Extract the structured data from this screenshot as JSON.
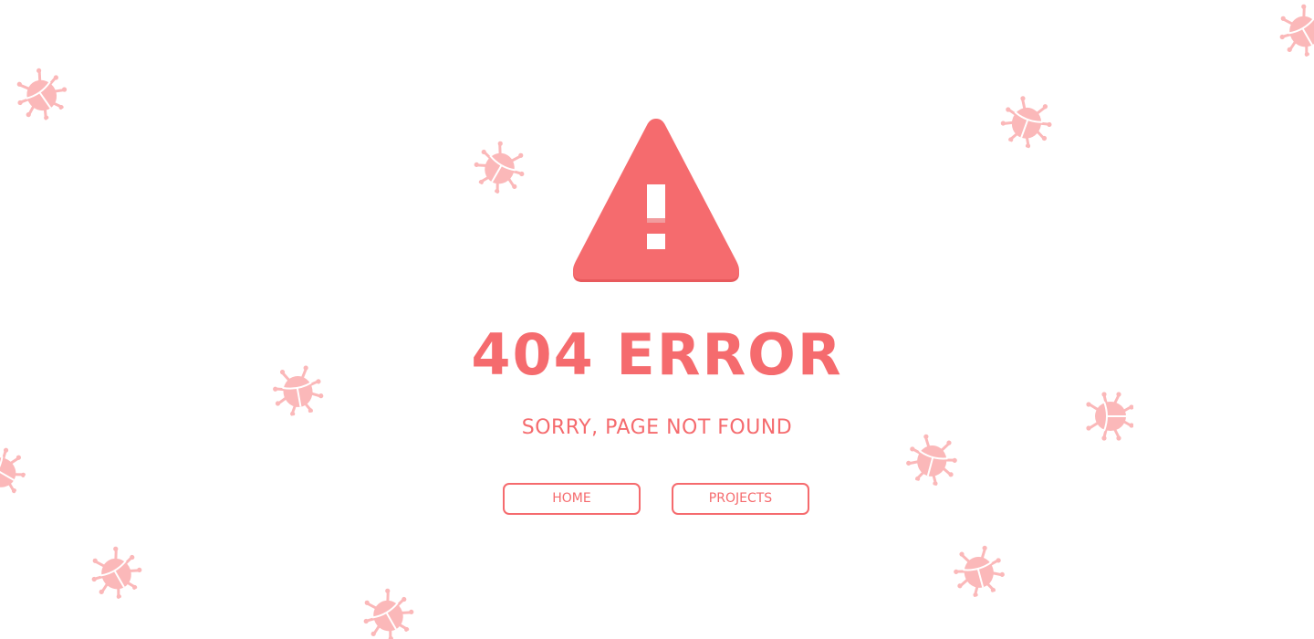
{
  "error": {
    "title": "404 ERROR",
    "subtitle": "SORRY, PAGE NOT FOUND"
  },
  "nav": {
    "home_label": "HOME",
    "projects_label": "PROJECTS"
  },
  "icons": {
    "warning": "warning-triangle-icon",
    "decoration": "bug-icon"
  },
  "colors": {
    "accent": "#f56b6e",
    "bug": "#fbb8b9",
    "background": "#ffffff"
  }
}
